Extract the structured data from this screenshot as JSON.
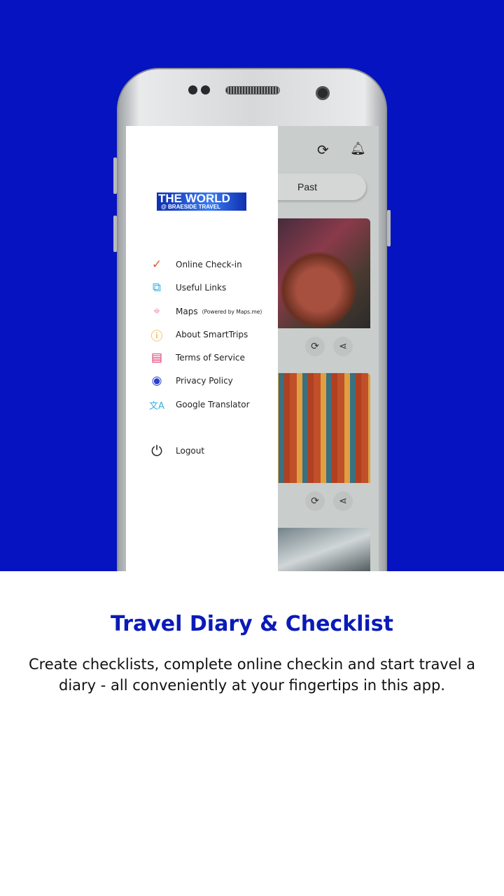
{
  "app": {
    "past_tab": "Past",
    "refresh_icon": "refresh-icon",
    "bell_icon": "bell-icon"
  },
  "drawer": {
    "logo": {
      "line1": "THE WORLD",
      "line2": "@ BRAESIDE TRAVEL"
    },
    "items": [
      {
        "label": "Online Check-in",
        "icon": "check-location-icon",
        "color": "#e8542e"
      },
      {
        "label": "Useful Links",
        "icon": "link-icon",
        "color": "#3ab0e0"
      },
      {
        "label": "Maps",
        "sub": "(Powered by Maps.me)",
        "icon": "map-pin-icon",
        "color": "#f0a0b0"
      },
      {
        "label": "About SmartTrips",
        "icon": "info-icon",
        "color": "#f0a020"
      },
      {
        "label": "Terms of Service",
        "icon": "document-icon",
        "color": "#e0306a"
      },
      {
        "label": "Privacy Policy",
        "icon": "eye-icon",
        "color": "#2a40d0"
      },
      {
        "label": "Google Translator",
        "icon": "translate-icon",
        "color": "#3ab0e0"
      }
    ],
    "logout": {
      "label": "Logout",
      "icon": "power-icon"
    }
  },
  "headline": "Travel Diary & Checklist",
  "description": "Create checklists, complete online checkin and start travel a diary - all conveniently at your fingertips in this app.",
  "colors": {
    "background": "#0613c0",
    "headline": "#0a1bb8"
  }
}
